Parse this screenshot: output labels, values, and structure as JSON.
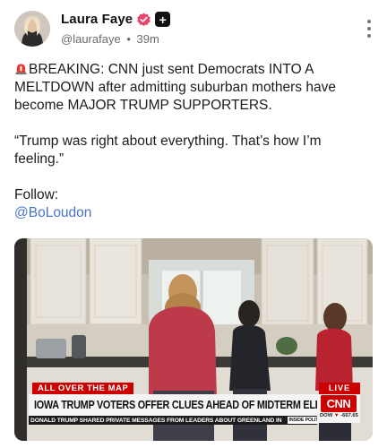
{
  "post": {
    "author_name": "Laura Faye",
    "handle": "@laurafaye",
    "separator": "•",
    "time": "39m",
    "plus_badge": "+",
    "lines": [
      "BREAKING: CNN just sent Democrats INTO A MELTDOWN after admitting suburban mothers have become MAJOR TRUMP SUPPORTERS.",
      "“Trump was right about everything. That’s how I’m feeling.”",
      "Follow:"
    ],
    "mention": "@BoLoudon"
  },
  "video": {
    "section_tag": "ALL OVER THE MAP",
    "live_tag": "LIVE",
    "headline": "IOWA TRUMP VOTERS OFFER CLUES AHEAD OF MIDTERM ELECTIONS",
    "logo": "CNN",
    "dow_label": "DOW",
    "dow_arrow": "▼",
    "dow_change": "-667.65",
    "ticker": "DONALD TRUMP SHARED PRIVATE MESSAGES FROM LEADERS ABOUT GREENLAND IN",
    "ticker_tag": "INSIDE POLITICS"
  },
  "icons": {
    "verified": "verified-badge-icon",
    "more": "more-options-icon",
    "siren": "siren-emoji-icon"
  },
  "colors": {
    "verified_pink": "#e8436b",
    "link_blue": "#4a73c9",
    "cnn_red": "#cc0000"
  }
}
